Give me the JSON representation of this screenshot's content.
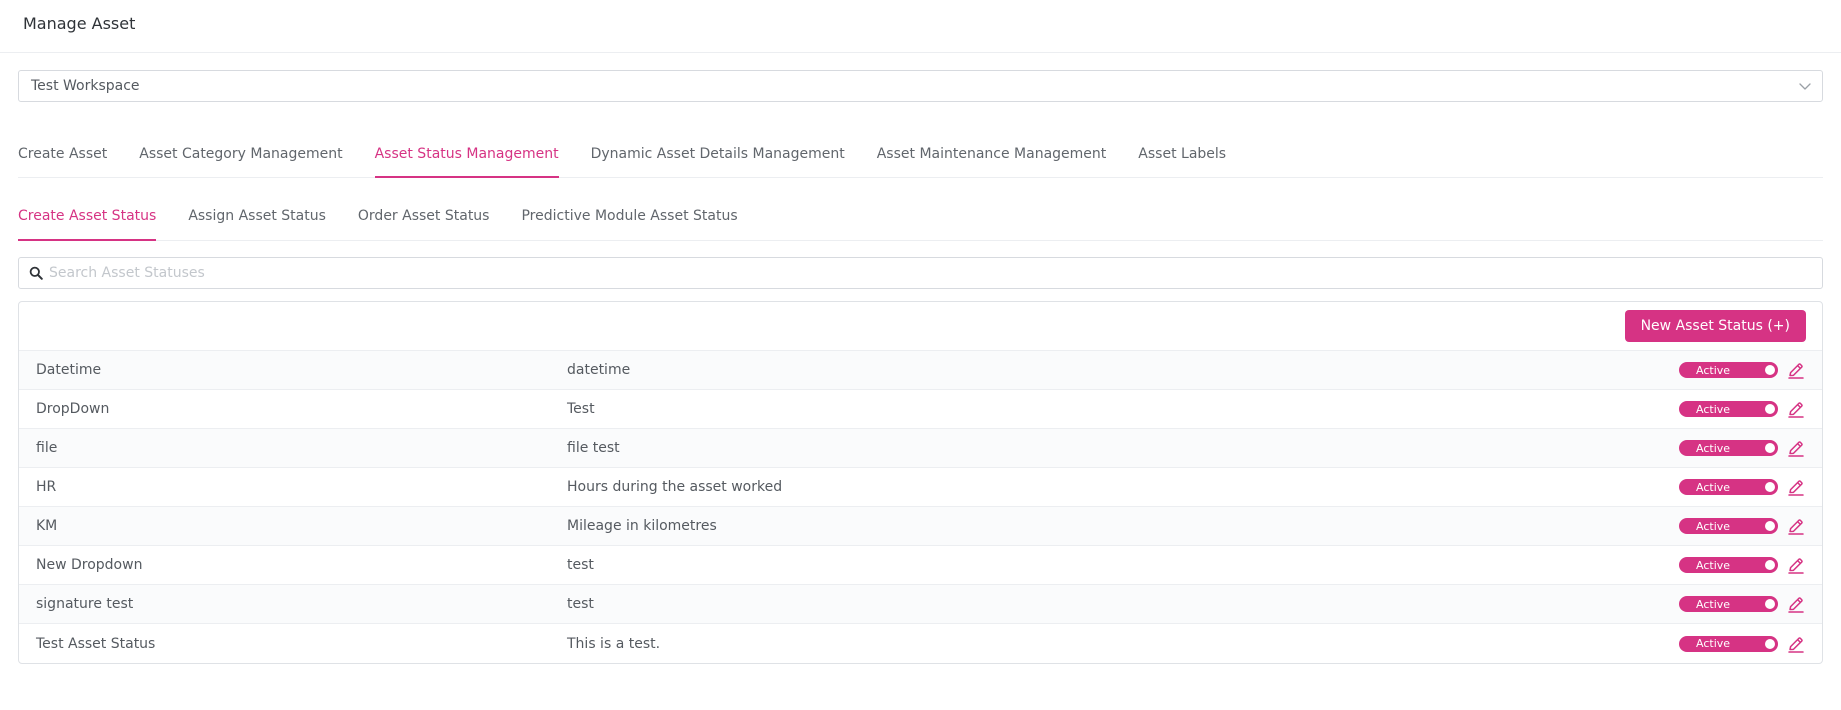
{
  "header": {
    "title": "Manage Asset"
  },
  "workspace": {
    "selected": "Test Workspace"
  },
  "main_tabs": [
    {
      "label": "Create Asset",
      "active": false
    },
    {
      "label": "Asset Category Management",
      "active": false
    },
    {
      "label": "Asset Status Management",
      "active": true
    },
    {
      "label": "Dynamic Asset Details Management",
      "active": false
    },
    {
      "label": "Asset Maintenance Management",
      "active": false
    },
    {
      "label": "Asset Labels",
      "active": false
    }
  ],
  "sub_tabs": [
    {
      "label": "Create Asset Status",
      "active": true
    },
    {
      "label": "Assign Asset Status",
      "active": false
    },
    {
      "label": "Order Asset Status",
      "active": false
    },
    {
      "label": "Predictive Module Asset Status",
      "active": false
    }
  ],
  "search": {
    "placeholder": "Search Asset Statuses",
    "value": ""
  },
  "toolbar": {
    "new_button_label": "New Asset Status (+)"
  },
  "statuses": [
    {
      "name": "Datetime",
      "description": "datetime",
      "status": "Active"
    },
    {
      "name": "DropDown",
      "description": "Test",
      "status": "Active"
    },
    {
      "name": "file",
      "description": "file test",
      "status": "Active"
    },
    {
      "name": "HR",
      "description": "Hours during the asset worked",
      "status": "Active"
    },
    {
      "name": "KM",
      "description": "Mileage in kilometres",
      "status": "Active"
    },
    {
      "name": "New Dropdown",
      "description": "test",
      "status": "Active"
    },
    {
      "name": "signature test",
      "description": "test",
      "status": "Active"
    },
    {
      "name": "Test Asset Status",
      "description": "This is a test.",
      "status": "Active"
    }
  ],
  "icons": {
    "search": "search-icon",
    "dropdown": "chevron-down-icon",
    "edit": "pencil-icon"
  },
  "colors": {
    "accent": "#d63384",
    "text": "#555a60",
    "border": "#d7dadf"
  }
}
